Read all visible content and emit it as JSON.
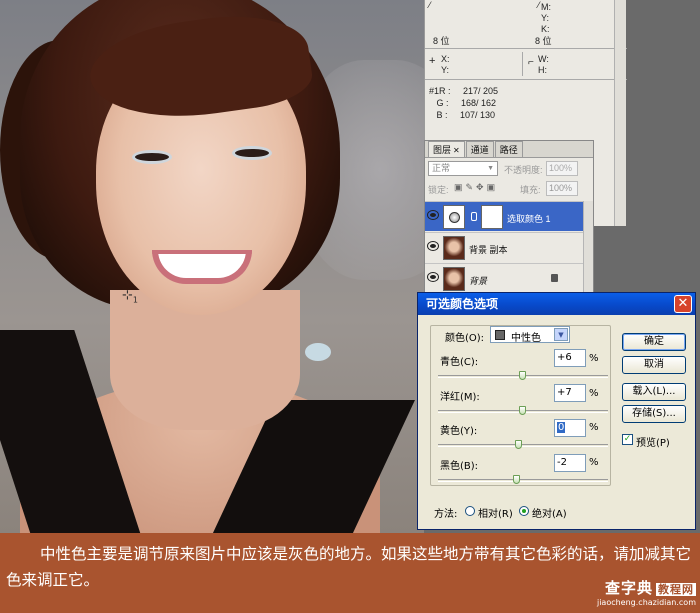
{
  "sampler": {
    "number": "1"
  },
  "info": {
    "cmyk_labels": [
      "M:",
      "Y:",
      "K:"
    ],
    "bit_depth_left": "8 位",
    "bit_depth_right": "8 位",
    "x_label": "X:",
    "y_label": "Y:",
    "w_label": "W:",
    "h_label": "H:",
    "sampler_rows": [
      "#1R :     217/ 205",
      "   G :     168/ 162",
      "   B :     107/ 130"
    ]
  },
  "layers": {
    "tabs": [
      "图层",
      "通道",
      "路径"
    ],
    "blend_mode": "正常",
    "opacity_label": "不透明度:",
    "opacity_value": "100%",
    "lock_label": "锁定:",
    "fill_label": "填充:",
    "fill_value": "100%",
    "items": [
      "选取颜色 1",
      "背景 副本",
      "背景"
    ]
  },
  "dialog": {
    "title": "可选颜色选项",
    "colors_label": "颜色(O):",
    "colors_value": "中性色",
    "percent": "%",
    "sliders": [
      {
        "label": "青色(C):",
        "value": "+6"
      },
      {
        "label": "洋红(M):",
        "value": "+7"
      },
      {
        "label": "黄色(Y):",
        "value": "0"
      },
      {
        "label": "黑色(B):",
        "value": "-2"
      }
    ],
    "buttons": [
      "确定",
      "取消",
      "载入(L)...",
      "存储(S)..."
    ],
    "preview_label": "预览(P)",
    "method_label": "方法:",
    "methods": [
      "相对(R)",
      "绝对(A)"
    ]
  },
  "caption": {
    "text": "中性色主要是调节原来图片中应该是灰色的地方。如果这些地方带有其它色彩的话，请加减其它色来调正它。"
  },
  "watermark": {
    "brand": "查字典",
    "tag": "教程网",
    "url": "jiaocheng.chazidian.com"
  },
  "colors": {
    "accent": "#0a5ee8",
    "caption_bg": "#a9542f",
    "selected_layer": "#3a66c6"
  }
}
